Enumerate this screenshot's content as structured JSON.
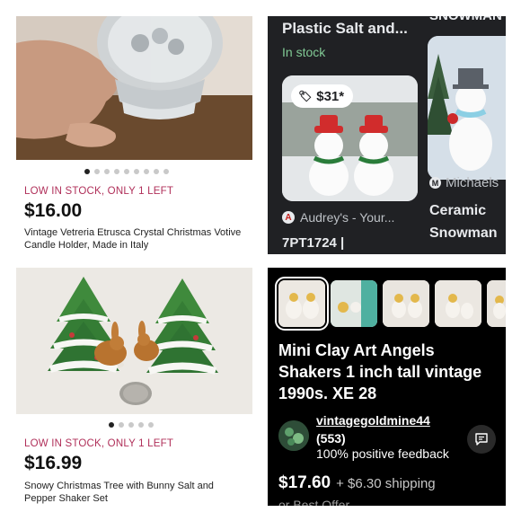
{
  "listings": [
    {
      "stock": "LOW IN STOCK, ONLY 1 LEFT",
      "price": "$16.00",
      "title": "Vintage Vetreria Etrusca Crystal Christmas Votive Candle Holder, Made in Italy",
      "carousel": {
        "total": 9,
        "active": 1
      }
    },
    {
      "stock": "LOW IN STOCK, ONLY 1 LEFT",
      "price": "$16.99",
      "title": "Snowy Christmas Tree with Bunny Salt and Pepper Shaker Set",
      "carousel": {
        "total": 5,
        "active": 1
      }
    }
  ],
  "shopping": {
    "product_title": "Plastic Salt and...",
    "availability": "In stock",
    "price_tag": "$31*",
    "seller": "Audrey's - Your...",
    "code": "7PT1724 |",
    "side_seller": "Michaels",
    "side_title_1": "Ceramic",
    "side_title_2": "Snowman",
    "top_right_cut": "SNOWMAN"
  },
  "ebay": {
    "title": "Mini Clay Art Angels Shakers 1 inch tall vintage 1990s. XE 28",
    "seller_name": "vintagegoldmine44",
    "feedback_count": "(553)",
    "feedback_pct": "100% positive feedback",
    "price": "$17.60",
    "shipping": "+ $6.30 shipping",
    "best_offer": "or Best Offer"
  },
  "colors": {
    "stock": "#b0305a",
    "in_stock": "#81c995",
    "dark_bg": "#202124"
  }
}
